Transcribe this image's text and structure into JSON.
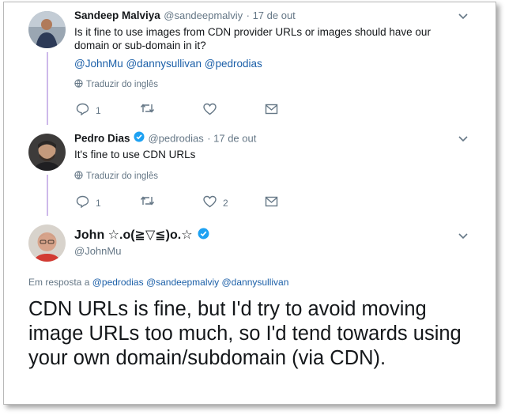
{
  "tweets": [
    {
      "name": "Sandeep Malviya",
      "handle": "@sandeepmalviy",
      "date": "· 17 de out",
      "text": "Is it fine to use images from CDN provider URLs or images should have our domain or sub-domain in it?",
      "mentions": "@JohnMu @dannysullivan @pedrodias",
      "translate": "Traduzir do inglês",
      "reply_count": "1",
      "retweet_count": "",
      "like_count": ""
    },
    {
      "name": "Pedro Dias",
      "handle": "@pedrodias",
      "date": "· 17 de out",
      "text": "It's fine to use CDN URLs",
      "translate": "Traduzir do inglês",
      "reply_count": "1",
      "retweet_count": "",
      "like_count": "2"
    }
  ],
  "main_tweet": {
    "name": "John ☆.o(≧▽≦)o.☆",
    "handle": "@JohnMu",
    "reply_prefix": "Em resposta a",
    "reply_to": "@pedrodias @sandeepmalviy @dannysullivan",
    "text": "CDN URLs is fine, but I'd try to avoid moving image URLs too much, so I'd tend towards using your own domain/subdomain (via CDN)."
  },
  "colors": {
    "link": "#1b5fa8",
    "verified": "#1da1f2",
    "thread_line": "#cdb8ea",
    "muted": "#657786"
  },
  "icons": [
    "chevron-down-icon",
    "globe-icon",
    "reply-icon",
    "retweet-icon",
    "like-icon",
    "message-icon",
    "verified-icon"
  ]
}
